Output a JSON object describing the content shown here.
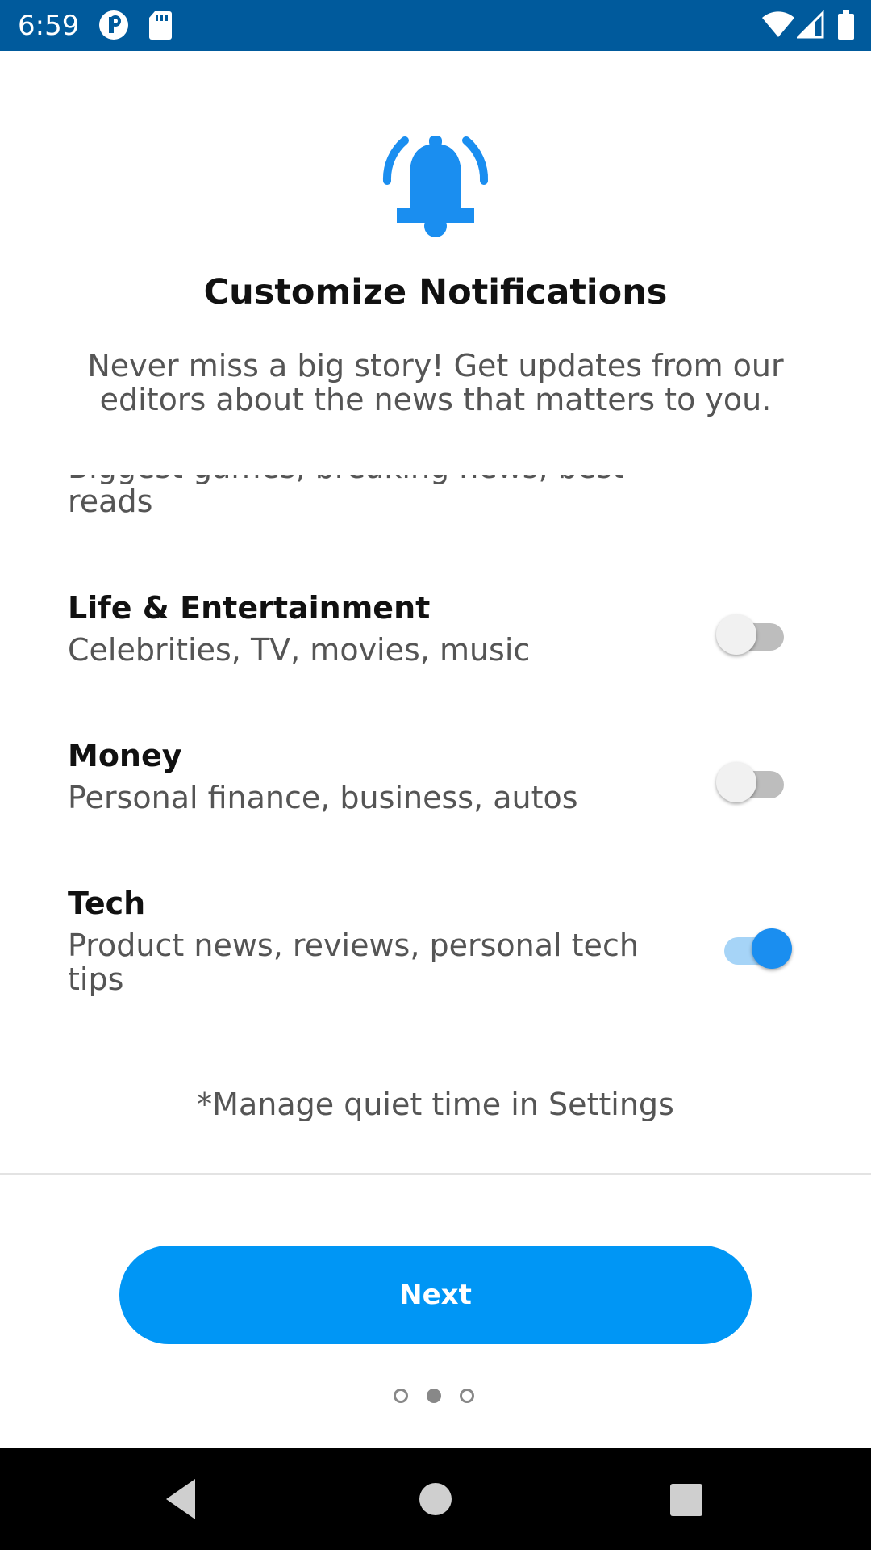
{
  "status_bar": {
    "time": "6:59",
    "background": "#005a9c",
    "icons": [
      "p-logo-icon",
      "sd-card-icon",
      "wifi-icon",
      "cell-signal-icon",
      "battery-icon"
    ]
  },
  "header": {
    "icon": "bell-icon",
    "title": "Customize Notifications",
    "subtitle": "Never miss a big story! Get updates from our editors about the news that matters to you."
  },
  "categories": [
    {
      "title": "",
      "desc": "Biggest games, breaking news, best reads",
      "enabled": true
    },
    {
      "title": "Life & Entertainment",
      "desc": "Celebrities, TV, movies, music",
      "enabled": false
    },
    {
      "title": "Money",
      "desc": "Personal finance, business, autos",
      "enabled": false
    },
    {
      "title": "Tech",
      "desc": "Product news, reviews, personal tech tips",
      "enabled": true
    }
  ],
  "footer_note": "*Manage quiet time in Settings",
  "next_button": {
    "label": "Next",
    "color": "#0096f5"
  },
  "pager": {
    "total": 3,
    "current": 2
  },
  "nav_bar": {
    "buttons": [
      "back-icon",
      "home-icon",
      "recents-icon"
    ]
  },
  "accent_color": "#1a8ef0"
}
